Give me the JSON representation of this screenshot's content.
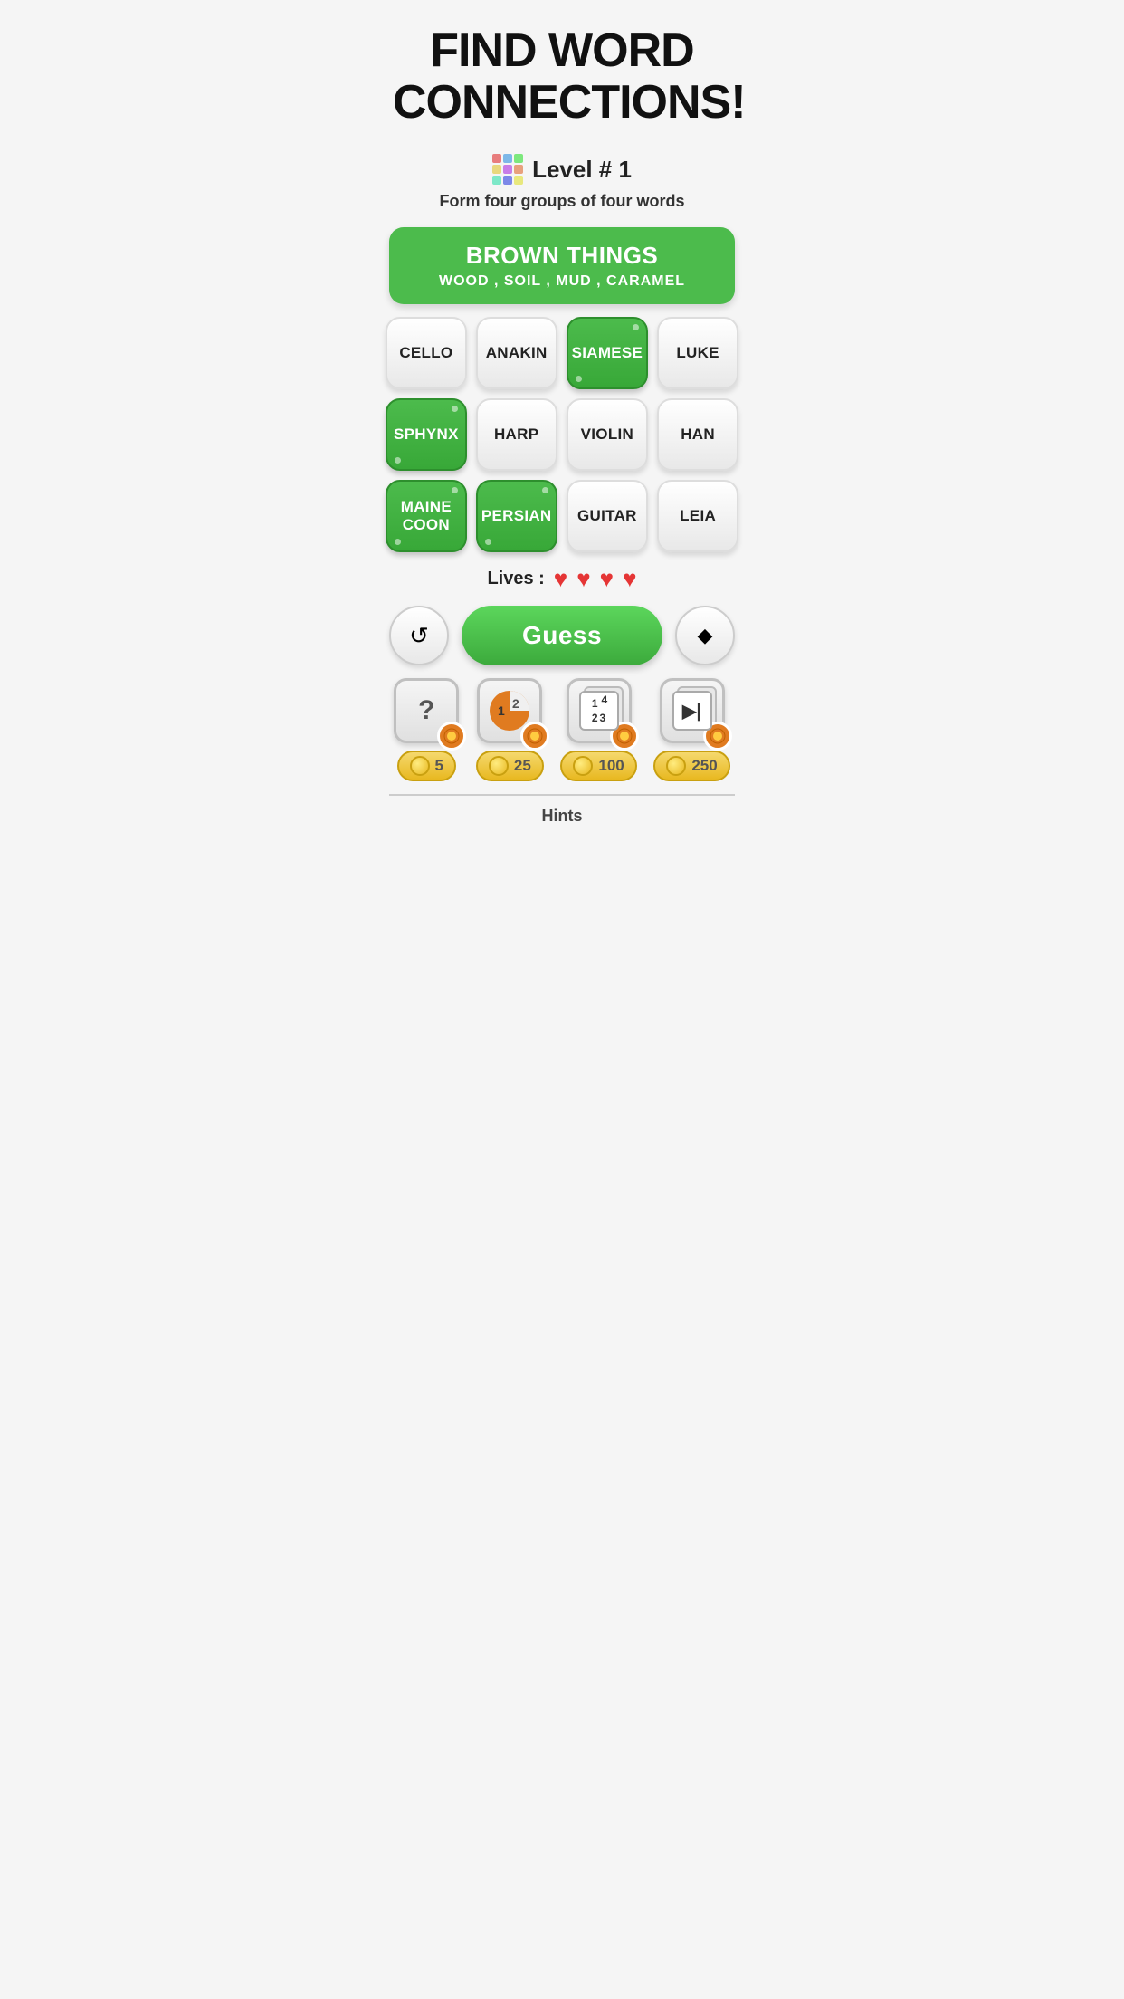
{
  "title": "FIND WORD CONNECTIONS!",
  "level": {
    "label": "Level # 1",
    "icon_colors": [
      "#e87d7d",
      "#7db8e8",
      "#7de87d",
      "#e8d87d",
      "#c87de8",
      "#e8a07d",
      "#7de8c8",
      "#7d88e8",
      "#e8e87d"
    ]
  },
  "subtitle": "Form four groups of four words",
  "banner": {
    "title": "BROWN THINGS",
    "subtitle": "WOOD , SOIL , MUD , CARAMEL"
  },
  "tiles": [
    {
      "label": "CELLO",
      "selected": false
    },
    {
      "label": "ANAKIN",
      "selected": false
    },
    {
      "label": "SIAMESE",
      "selected": true
    },
    {
      "label": "LUKE",
      "selected": false
    },
    {
      "label": "SPHYNX",
      "selected": true
    },
    {
      "label": "HARP",
      "selected": false
    },
    {
      "label": "VIOLIN",
      "selected": false
    },
    {
      "label": "HAN",
      "selected": false
    },
    {
      "label": "MAINE\nCOON",
      "selected": true
    },
    {
      "label": "PERSIAN",
      "selected": true
    },
    {
      "label": "GUITAR",
      "selected": false
    },
    {
      "label": "LEIA",
      "selected": false
    }
  ],
  "lives": {
    "label": "Lives :",
    "count": 4
  },
  "buttons": {
    "refresh": "↺",
    "guess": "Guess",
    "erase": "◆"
  },
  "hints": [
    {
      "icon": "?",
      "cost": "5",
      "type": "question"
    },
    {
      "icon": "12",
      "cost": "25",
      "type": "pie"
    },
    {
      "icon": "123",
      "cost": "100",
      "type": "numgrid"
    },
    {
      "icon": "▶|",
      "cost": "250",
      "type": "skip"
    }
  ],
  "hints_label": "Hints"
}
